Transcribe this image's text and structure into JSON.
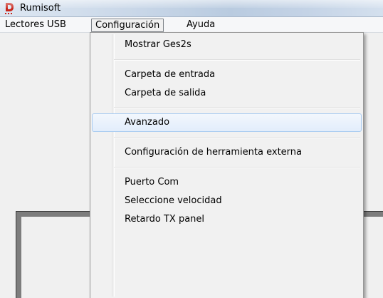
{
  "window": {
    "title": "Rumisoft"
  },
  "menubar": {
    "items": [
      {
        "label": "Lectores USB"
      },
      {
        "label": "Configuración"
      },
      {
        "label": "Ayuda"
      }
    ]
  },
  "dropdown": {
    "items": [
      {
        "label": "Mostrar Ges2s"
      },
      {
        "label": "Carpeta de entrada"
      },
      {
        "label": "Carpeta de salida"
      },
      {
        "label": "Avanzado"
      },
      {
        "label": "Configuración de herramienta externa"
      },
      {
        "label": "Puerto Com"
      },
      {
        "label": "Seleccione velocidad"
      },
      {
        "label": "Retardo TX panel"
      }
    ],
    "hovered": "Avanzado"
  },
  "icons": {
    "app": "rumisoft-app-icon"
  },
  "colors": {
    "hover_border": "#aaccf1",
    "panel": "#7d7d7d",
    "app_icon": "#c8261c"
  }
}
